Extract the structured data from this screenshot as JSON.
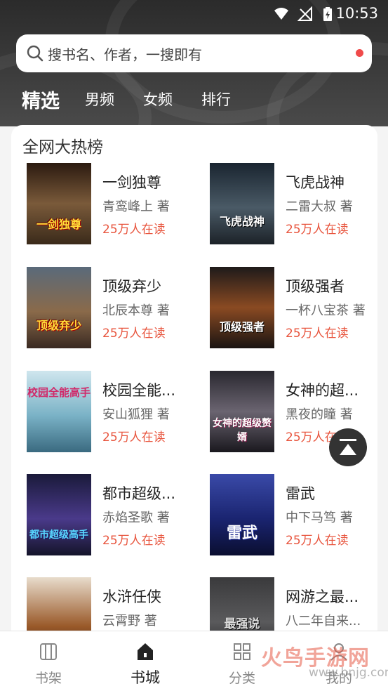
{
  "status": {
    "time": "10:53"
  },
  "search": {
    "placeholder": "搜书名、作者，一搜即有"
  },
  "tabs": [
    {
      "label": "精选",
      "active": true
    },
    {
      "label": "男频",
      "active": false
    },
    {
      "label": "女频",
      "active": false
    },
    {
      "label": "排行",
      "active": false
    }
  ],
  "section": {
    "title": "全网大热榜"
  },
  "books": [
    {
      "name": "一剑独尊",
      "author": "青鸾峰上 著",
      "readers": "25万人在读",
      "cover_text": "一剑独尊",
      "cover_color": "#5a3a22"
    },
    {
      "name": "飞虎战神",
      "author": "二雷大叔 著",
      "readers": "25万人在读",
      "cover_text": "飞虎战神",
      "cover_color": "#2e3a44"
    },
    {
      "name": "顶级弃少",
      "author": "北辰本尊 著",
      "readers": "25万人在读",
      "cover_text": "顶级弃少",
      "cover_color": "#6a5a4a"
    },
    {
      "name": "顶级强者",
      "author": "一杯八宝茶 著",
      "readers": "25万人在读",
      "cover_text": "顶级强者",
      "cover_color": "#4a3a30"
    },
    {
      "name": "校园全能...",
      "author": "安山狐狸 著",
      "readers": "25万人在读",
      "cover_text": "校园全能高手",
      "cover_color": "#6aa4b8"
    },
    {
      "name": "女神的超...",
      "author": "黑夜的瞳 著",
      "readers": "25万人在",
      "cover_text": "女神的超级赘婿",
      "cover_color": "#3a3640"
    },
    {
      "name": "都市超级...",
      "author": "赤焰圣歌 著",
      "readers": "25万人在读",
      "cover_text": "都市超级高手",
      "cover_color": "#2a3a6a"
    },
    {
      "name": "雷武",
      "author": "中下马笃 著",
      "readers": "25万人在读",
      "cover_text": "雷武",
      "cover_color": "#2a3a8a"
    },
    {
      "name": "水浒任侠",
      "author": "云霄野 著",
      "readers": "",
      "cover_text": "",
      "cover_color": "#7a4a2a"
    },
    {
      "name": "网游之最...",
      "author": "八二年自来...",
      "readers": "",
      "cover_text": "最强说",
      "cover_color": "#2e2e30"
    }
  ],
  "nav": [
    {
      "label": "书架",
      "icon": "bookshelf-icon",
      "active": false
    },
    {
      "label": "书城",
      "icon": "home-icon",
      "active": true
    },
    {
      "label": "分类",
      "icon": "category-grid-icon",
      "active": false
    },
    {
      "label": "我的",
      "icon": "profile-icon",
      "active": false
    }
  ],
  "watermark": {
    "text": "火鸟手游网",
    "sub": "www.hnjg.com"
  }
}
